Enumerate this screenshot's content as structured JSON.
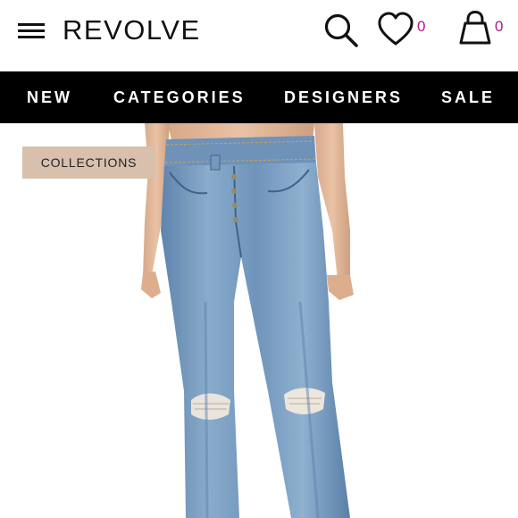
{
  "header": {
    "logo": "REVOLVE",
    "menu_icon": "hamburger-menu-icon",
    "search_icon": "search-icon",
    "wishlist_icon": "heart-icon",
    "wishlist_count": "0",
    "bag_icon": "shopping-bag-icon",
    "bag_count": "0",
    "count_color": "#b0178f"
  },
  "nav": {
    "items": [
      {
        "label": "NEW"
      },
      {
        "label": "CATEGORIES"
      },
      {
        "label": "DESIGNERS"
      },
      {
        "label": "SALE"
      }
    ],
    "background": "#000000",
    "text_color": "#ffffff"
  },
  "collections_button": {
    "label": "COLLECTIONS",
    "background": "#d8c0ad"
  }
}
